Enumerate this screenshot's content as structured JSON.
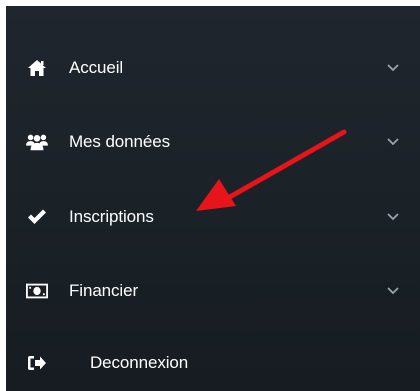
{
  "colors": {
    "sidebar_background": "#1c2329",
    "text": "#ffffff",
    "chevron": "#9aa3ab",
    "arrow": "#e8141b"
  },
  "nav": {
    "items": [
      {
        "label": "Accueil",
        "icon": "home-icon",
        "has_submenu": true
      },
      {
        "label": "Mes données",
        "icon": "users-icon",
        "has_submenu": true
      },
      {
        "label": "Inscriptions",
        "icon": "checkmark-icon",
        "has_submenu": true
      },
      {
        "label": "Financier",
        "icon": "money-icon",
        "has_submenu": true
      },
      {
        "label": "Deconnexion",
        "icon": "sign-out-icon",
        "has_submenu": false
      }
    ]
  }
}
